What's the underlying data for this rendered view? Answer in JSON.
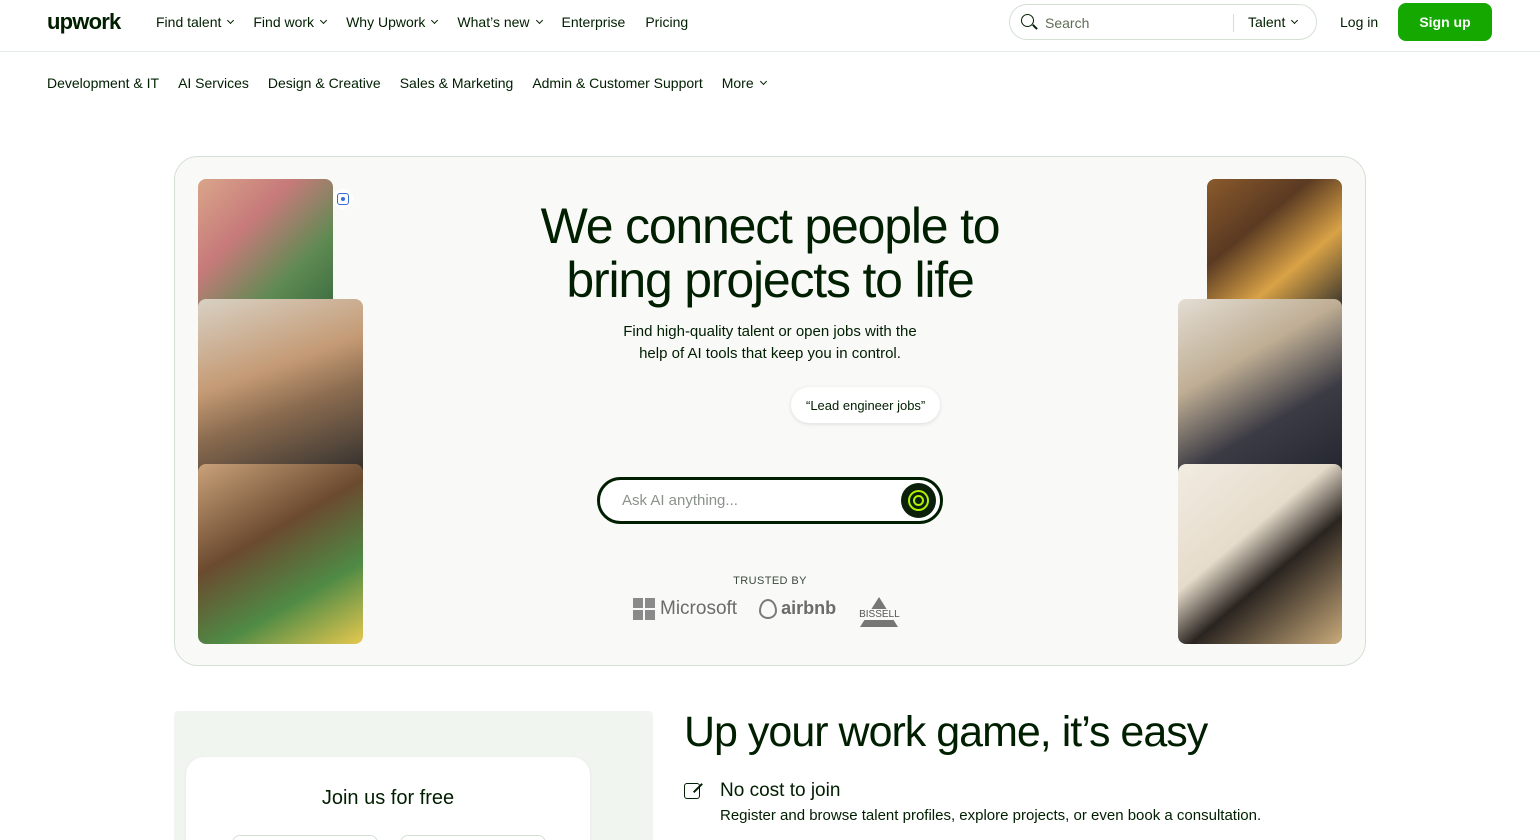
{
  "header": {
    "logo": "upwork",
    "nav": [
      "Find talent",
      "Find work",
      "Why Upwork",
      "What’s new",
      "Enterprise",
      "Pricing"
    ],
    "search_placeholder": "Search",
    "search_scope": "Talent",
    "login": "Log in",
    "signup": "Sign up"
  },
  "categories": [
    "Development & IT",
    "AI Services",
    "Design & Creative",
    "Sales & Marketing",
    "Admin & Customer Support",
    "More"
  ],
  "hero": {
    "title_line1": "We connect people to",
    "title_line2": "bring projects to life",
    "subtitle_line1": "Find high-quality talent or open jobs with the",
    "subtitle_line2": "help of AI tools that keep you in control.",
    "suggestion_chip": "“Lead engineer jobs”",
    "ai_placeholder": "Ask AI anything...",
    "trusted_by": "TRUSTED BY",
    "trusted_logos": [
      "Microsoft",
      "airbnb",
      "BISSELL"
    ]
  },
  "join": {
    "title": "Join us for free"
  },
  "easy": {
    "title": "Up your work game, it’s easy",
    "feature_title": "No cost to join",
    "feature_desc": "Register and browse talent profiles, explore projects, or even book a consultation."
  },
  "colors": {
    "brand_green": "#14a800",
    "text_dark": "#001e00",
    "ai_accent": "#b0f000"
  }
}
